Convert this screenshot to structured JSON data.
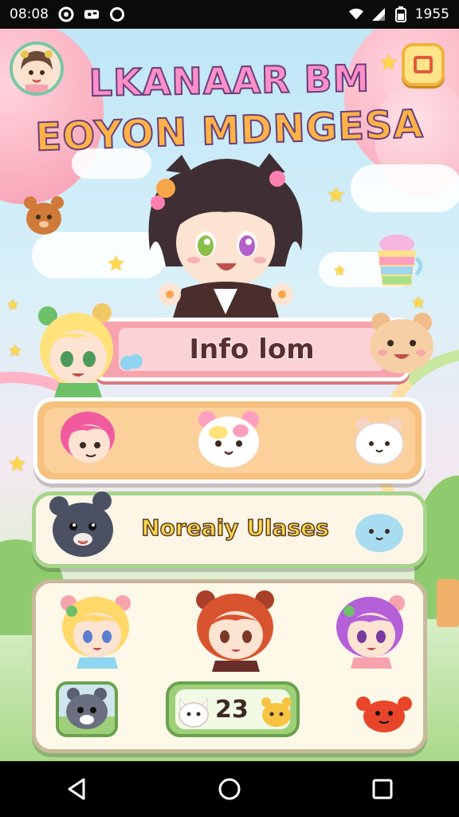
{
  "status_bar": {
    "time": "08:08",
    "battery_text": "1955",
    "icons": [
      "notification-icon",
      "photo-icon",
      "circle-icon",
      "wifi-icon",
      "signal-icon",
      "battery-icon"
    ]
  },
  "title": {
    "line1": "LKANAAR BM",
    "line2": "EOYON MDNGESA"
  },
  "buttons": {
    "info_label": "Info lom",
    "novelty_label": "Noreaiy Ulases",
    "count_label": "23"
  },
  "icons": {
    "profile": "profile-avatar-icon",
    "menu": "menu-square-icon"
  },
  "colors": {
    "banner": "#f6a3ad",
    "orange_panel": "#f6c07f",
    "cream_panel": "#fdf6e6",
    "accent_green": "#6aa24e"
  },
  "nav": {
    "back": "back-icon",
    "home": "home-icon",
    "recents": "recents-icon"
  }
}
